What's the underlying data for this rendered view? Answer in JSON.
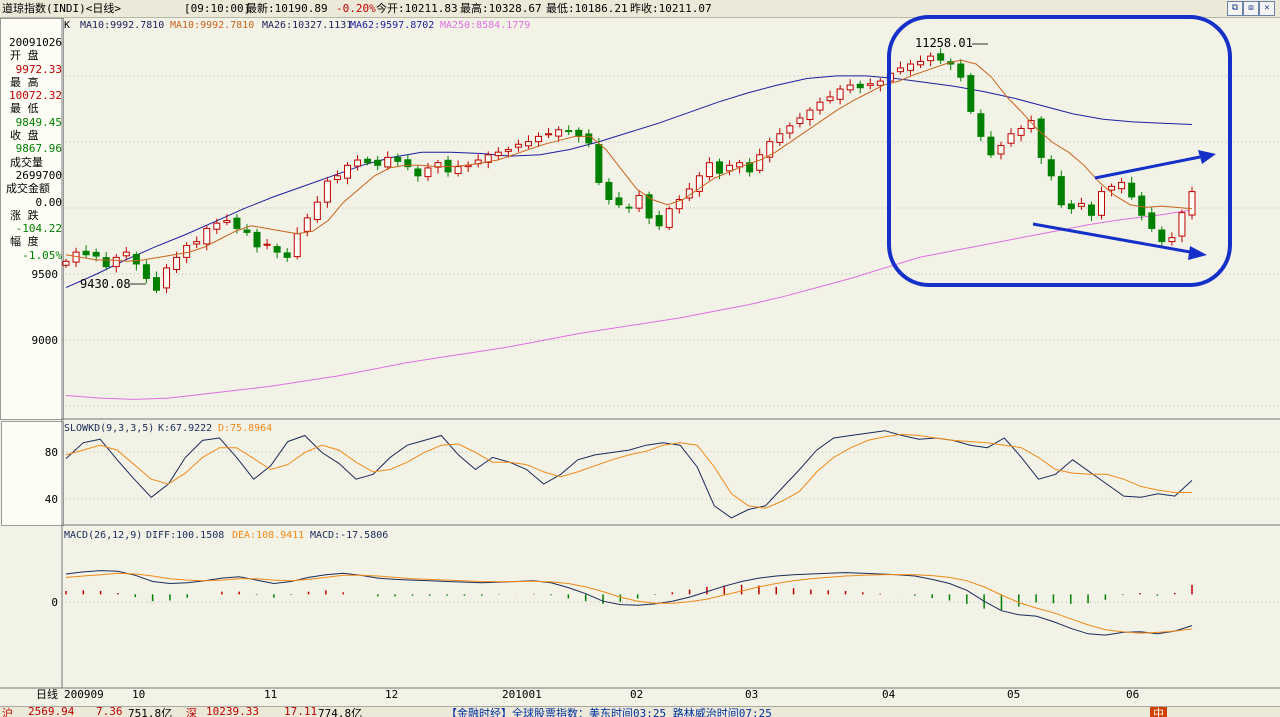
{
  "header": {
    "title": "道琼指数(INDI)<日线>",
    "time": "[09:10:00]",
    "latest": "最新:10190.89",
    "change_pct": "-0.20%",
    "open": "今开:10211.83",
    "high": "最高:10328.67",
    "low": "最低:10186.21",
    "prev_close": "昨收:10211.07",
    "window_buttons": [
      "⧉",
      "⧈",
      "✕"
    ]
  },
  "side": {
    "date": "20091026",
    "open_label": "开  盘",
    "open_value": "9972.33",
    "high_label": "最  高",
    "high_value": "10072.32",
    "low_label": "最  低",
    "low_value": "9849.45",
    "close_label": "收  盘",
    "close_value": "9867.96",
    "vol_label": "成交量",
    "vol_value": "2699700",
    "amount_label": "成交金额",
    "amount_value": "0.00",
    "chg_label": "涨  跌",
    "chg_value": "-104.22",
    "pct_label": "幅  度",
    "pct_value": "-1.05%"
  },
  "main_legend": {
    "k": "K",
    "ma10": "MA10:9992.7810",
    "ma10b": "MA10:9992.7810",
    "ma26": "MA26:10327.1131",
    "ma62": "MA62:9597.8702",
    "ma250": "MA250:8584.1779"
  },
  "annotations": {
    "high": "11258.01",
    "low": "9430.08"
  },
  "kd_legend": {
    "name": "SLOWKD(9,3,3,5)",
    "k": "K:67.9222",
    "d": "D:75.8964"
  },
  "macd_legend": {
    "name": "MACD(26,12,9)",
    "diff": "DIFF:100.1508",
    "dea": "DEA:108.9411",
    "macd": "MACD:-17.5806"
  },
  "date_axis": {
    "label": "日线",
    "ticks": [
      "200909",
      "10",
      "11",
      "12",
      "201001",
      "02",
      "03",
      "04",
      "05",
      "06"
    ]
  },
  "status": {
    "i1": "沪",
    "i1v": "2569.94",
    "i1c": "7.36",
    "i1a": "751.8亿",
    "i2": "深",
    "i2v": "10239.33",
    "i2c": "17.11",
    "i2a": "774.8亿",
    "news": "【金融时经】全球股票指数：美东时间03:25 路林威治时间07:25",
    "ime": "中"
  },
  "colors": {
    "up": "#c00000",
    "down": "#008000",
    "ma10": "#c8641e",
    "ma62": "#1e1ea0",
    "ma250": "#e070e0",
    "k_line": "#1a2a5a",
    "d_line": "#f08a1a",
    "highlight": "#1530c8"
  },
  "chart_data": [
    {
      "type": "candlestick",
      "title": "道琼指数(INDI)<日线>",
      "x_range": [
        "2009-09",
        "2010-06"
      ],
      "y_ticks": [
        9000,
        9500
      ],
      "ylim": [
        8550,
        11500
      ],
      "close_series": [
        9650,
        9720,
        9700,
        9690,
        9610,
        9680,
        9720,
        9630,
        9520,
        9430,
        9600,
        9680,
        9770,
        9800,
        9900,
        9940,
        9960,
        9900,
        9870,
        9760,
        9780,
        9720,
        9680,
        9860,
        9980,
        10100,
        10260,
        10300,
        10380,
        10420,
        10400,
        10380,
        10440,
        10410,
        10370,
        10300,
        10360,
        10400,
        10330,
        10370,
        10380,
        10420,
        10460,
        10480,
        10500,
        10540,
        10560,
        10600,
        10620,
        10650,
        10640,
        10600,
        10550,
        10250,
        10120,
        10080,
        10060,
        10150,
        9980,
        9920,
        10050,
        10120,
        10200,
        10300,
        10400,
        10320,
        10380,
        10400,
        10330,
        10460,
        10560,
        10620,
        10680,
        10740,
        10800,
        10860,
        10900,
        10960,
        10990,
        10970,
        11000,
        11020,
        11080,
        11120,
        11150,
        11170,
        11210,
        11180,
        11150,
        11050,
        10790,
        10600,
        10460,
        10530,
        10620,
        10660,
        10720,
        10440,
        10300,
        10080,
        10050,
        10090,
        10000,
        10180,
        10220,
        10250,
        10140,
        10000,
        9900,
        9800,
        9830,
        10020,
        10180
      ],
      "ma10": [
        9700,
        9680,
        9660,
        9660,
        9650,
        9660,
        9680,
        9700,
        9720,
        9760,
        9820,
        9880,
        9920,
        9900,
        9880,
        9860,
        9880,
        9960,
        10100,
        10200,
        10300,
        10360,
        10380,
        10380,
        10370,
        10370,
        10380,
        10400,
        10420,
        10460,
        10500,
        10540,
        10570,
        10600,
        10600,
        10500,
        10350,
        10200,
        10120,
        10080,
        10120,
        10200,
        10280,
        10330,
        10380,
        10420,
        10480,
        10560,
        10640,
        10720,
        10800,
        10870,
        10930,
        10990,
        11020,
        11070,
        11110,
        11150,
        11180,
        11150,
        11050,
        10900,
        10780,
        10650,
        10550,
        10480,
        10380,
        10250,
        10150,
        10080,
        10060,
        10070,
        10060,
        10050
      ],
      "ma62": [
        9450,
        9550,
        9660,
        9760,
        9850,
        9950,
        10050,
        10140,
        10220,
        10300,
        10380,
        10440,
        10480,
        10480,
        10470,
        10450,
        10460,
        10500,
        10560,
        10630,
        10700,
        10780,
        10860,
        10930,
        10990,
        11040,
        11060,
        11060,
        11040,
        11010,
        10980,
        10940,
        10890,
        10830,
        10770,
        10730,
        10710,
        10700,
        10690
      ],
      "ma250": [
        8630,
        8610,
        8600,
        8610,
        8640,
        8670,
        8700,
        8740,
        8780,
        8830,
        8880,
        8920,
        8960,
        9000,
        9050,
        9100,
        9140,
        9180,
        9220,
        9270,
        9320,
        9380,
        9450,
        9520,
        9600,
        9680,
        9730,
        9780,
        9830,
        9880,
        9930,
        9970,
        10000,
        10040
      ],
      "annotation_high": 11258.01,
      "annotation_low": 9430.08
    },
    {
      "type": "line",
      "title": "SLOWKD(9,3,3,5)",
      "y_ticks": [
        40,
        80
      ],
      "ylim": [
        15,
        100
      ],
      "series": [
        {
          "name": "K",
          "values": [
            69,
            82,
            85,
            68,
            52,
            37,
            48,
            70,
            84,
            86,
            70,
            52,
            63,
            83,
            88,
            74,
            65,
            52,
            56,
            70,
            80,
            84,
            88,
            72,
            60,
            70,
            66,
            60,
            48,
            56,
            68,
            72,
            74,
            76,
            80,
            82,
            80,
            62,
            30,
            20,
            27,
            30,
            45,
            60,
            76,
            86,
            88,
            90,
            92,
            88,
            85,
            86,
            84,
            80,
            78,
            86,
            70,
            52,
            56,
            68,
            58,
            48,
            38,
            37,
            40,
            38,
            51
          ]
        },
        {
          "name": "D",
          "values": [
            72,
            76,
            80,
            76,
            64,
            52,
            48,
            57,
            70,
            78,
            78,
            69,
            60,
            64,
            74,
            80,
            76,
            66,
            58,
            60,
            66,
            74,
            80,
            81,
            74,
            66,
            66,
            64,
            58,
            54,
            58,
            63,
            68,
            72,
            75,
            80,
            82,
            80,
            62,
            40,
            30,
            28,
            34,
            42,
            58,
            70,
            78,
            84,
            87,
            89,
            88,
            86,
            84,
            83,
            82,
            80,
            78,
            70,
            60,
            57,
            56,
            56,
            52,
            46,
            43,
            41,
            41
          ]
        }
      ]
    },
    {
      "type": "bar",
      "title": "MACD(26,12,9)",
      "y_ticks": [
        0
      ],
      "ylim": [
        -310,
        180
      ],
      "series": [
        {
          "name": "DIFF",
          "values": [
            150,
            165,
            175,
            170,
            140,
            95,
            80,
            85,
            100,
            120,
            130,
            105,
            80,
            95,
            125,
            145,
            155,
            140,
            120,
            110,
            105,
            100,
            95,
            90,
            85,
            90,
            95,
            100,
            85,
            50,
            5,
            -50,
            -75,
            -80,
            -70,
            -50,
            -20,
            20,
            60,
            95,
            120,
            135,
            145,
            150,
            155,
            160,
            155,
            150,
            145,
            135,
            110,
            80,
            30,
            -50,
            -120,
            -150,
            -160,
            -200,
            -250,
            -290,
            -300,
            -280,
            -275,
            -290,
            -270,
            -230
          ]
        },
        {
          "name": "DEA",
          "values": [
            125,
            135,
            145,
            155,
            150,
            135,
            115,
            105,
            100,
            105,
            115,
            115,
            105,
            100,
            110,
            125,
            140,
            140,
            135,
            125,
            115,
            110,
            105,
            100,
            95,
            93,
            94,
            96,
            92,
            80,
            55,
            20,
            -20,
            -50,
            -65,
            -65,
            -55,
            -35,
            -5,
            25,
            55,
            80,
            100,
            115,
            125,
            135,
            140,
            145,
            146,
            145,
            138,
            125,
            100,
            55,
            -5,
            -60,
            -100,
            -135,
            -180,
            -225,
            -260,
            -275,
            -285,
            -280,
            -270,
            -255
          ]
        },
        {
          "name": "MACD",
          "values": [
            25,
            30,
            25,
            10,
            -20,
            -50,
            -45,
            -25,
            0,
            20,
            20,
            -5,
            -25,
            -5,
            20,
            30,
            15,
            0,
            -15,
            -15,
            -10,
            -10,
            -10,
            -10,
            -10,
            -3,
            1,
            4,
            -7,
            -30,
            -50,
            -70,
            -55,
            -30,
            -5,
            15,
            35,
            55,
            65,
            70,
            65,
            55,
            45,
            35,
            30,
            25,
            15,
            5,
            -1,
            -10,
            -28,
            -45,
            -70,
            -105,
            -115,
            -90,
            -60,
            -65,
            -70,
            -65,
            -40,
            -5,
            10,
            -10,
            10,
            70
          ]
        }
      ]
    }
  ]
}
